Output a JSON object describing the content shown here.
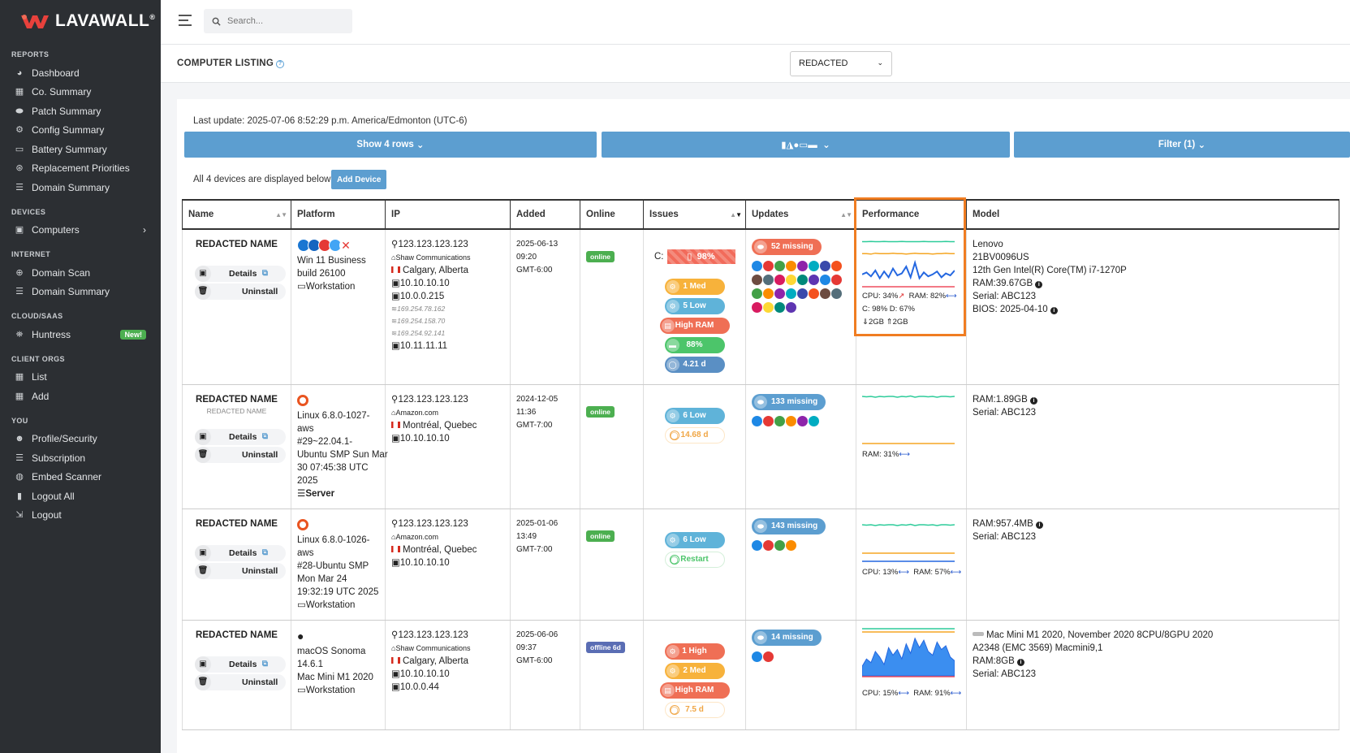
{
  "brand": {
    "name": "LAVAWALL",
    "reg": "®"
  },
  "sidebar": {
    "sections": [
      {
        "title": "REPORTS",
        "items": [
          {
            "label": "Dashboard",
            "icon": "dashboard-icon"
          },
          {
            "label": "Co. Summary",
            "icon": "building-icon"
          },
          {
            "label": "Patch Summary",
            "icon": "bandage-icon"
          },
          {
            "label": "Config Summary",
            "icon": "gear-icon"
          },
          {
            "label": "Battery Summary",
            "icon": "battery-icon"
          },
          {
            "label": "Replacement Priorities",
            "icon": "recycle-icon"
          },
          {
            "label": "Domain Summary",
            "icon": "list-icon"
          }
        ]
      },
      {
        "title": "DEVICES",
        "items": [
          {
            "label": "Computers",
            "icon": "desktop-icon",
            "chevron": "›"
          }
        ]
      },
      {
        "title": "INTERNET",
        "items": [
          {
            "label": "Domain Scan",
            "icon": "search-globe-icon"
          },
          {
            "label": "Domain Summary",
            "icon": "list-icon"
          }
        ]
      },
      {
        "title": "CLOUD/SAAS",
        "items": [
          {
            "label": "Huntress",
            "icon": "huntress-icon",
            "badge": "New!"
          }
        ]
      },
      {
        "title": "CLIENT ORGS",
        "items": [
          {
            "label": "List",
            "icon": "building-icon"
          },
          {
            "label": "Add",
            "icon": "building-add-icon"
          }
        ]
      },
      {
        "title": "YOU",
        "items": [
          {
            "label": "Profile/Security",
            "icon": "user-gear-icon"
          },
          {
            "label": "Subscription",
            "icon": "list-icon"
          },
          {
            "label": "Embed Scanner",
            "icon": "globe-icon"
          },
          {
            "label": "Logout All",
            "icon": "lock-icon"
          },
          {
            "label": "Logout",
            "icon": "logout-icon"
          }
        ]
      }
    ]
  },
  "topbar": {
    "search_placeholder": "Search..."
  },
  "page": {
    "title": "COMPUTER LISTING",
    "org_select": "REDACTED"
  },
  "content": {
    "last_update": "Last update: 2025-07-06 8:52:29 p.m. America/Edmonton (UTC-6)",
    "show_rows": "Show 4 rows",
    "platform_filter": "▮◮●▭▬",
    "filter": "Filter (1)",
    "device_count": "All 4 devices are displayed below",
    "add_device": "Add Device"
  },
  "table": {
    "headers": [
      "Name",
      "Platform",
      "IP",
      "Added",
      "Online",
      "Issues",
      "Updates",
      "Performance",
      "Model"
    ],
    "details_label": "Details",
    "uninstall_label": "Uninstall",
    "rows": [
      {
        "name": "REDACTED NAME",
        "subname": "",
        "platform_lines": [
          "Win 11 Business",
          "build 26100"
        ],
        "platform_type": "Workstation",
        "ip": {
          "public": "123.123.123.123",
          "isp": "Shaw Communications",
          "location": "Calgary, Alberta",
          "lines": [
            "10.10.10.10",
            "10.0.0.215"
          ],
          "small": [
            "169.254.78.162",
            "169.254.158.70",
            "169.254.92.141"
          ],
          "extra": "10.11.11.11"
        },
        "added": [
          "2025-06-13",
          "09:20",
          "GMT-6:00"
        ],
        "online": "online",
        "disk": {
          "label": "C:",
          "value": "98%"
        },
        "issues": [
          {
            "label": "1 Med",
            "kind": "med"
          },
          {
            "label": "5 Low",
            "kind": "low"
          },
          {
            "label": "High RAM",
            "kind": "ram"
          },
          {
            "label": "88%",
            "kind": "bat"
          },
          {
            "label": "4.21 d",
            "kind": "up"
          }
        ],
        "updates": {
          "label": "52 missing",
          "color": "red",
          "app_count": 28
        },
        "perf": {
          "text1": "CPU: 34%",
          "text1b": "RAM: 82%",
          "text2": "C: 98% D: 67%",
          "text3": "2GB",
          "text3b": "2GB",
          "cpu": [
            6,
            8,
            4,
            10,
            2,
            9,
            3,
            12,
            5,
            7,
            14,
            3,
            18,
            2,
            8,
            4,
            6,
            9,
            3,
            7,
            5,
            10
          ],
          "ram": [
            82,
            82,
            81,
            83,
            82,
            82,
            82,
            83,
            82,
            82,
            81,
            82,
            83,
            82,
            82,
            82,
            81,
            82,
            82,
            83,
            82,
            82
          ],
          "disk": [
            98,
            98,
            98,
            98,
            98,
            98,
            98,
            98,
            98,
            98,
            98,
            98,
            98,
            98,
            98,
            98,
            98,
            98,
            98,
            98,
            98,
            98
          ],
          "extra": [
            34,
            34,
            35,
            34,
            34,
            35,
            34,
            34,
            34,
            35,
            34,
            34,
            34,
            34,
            35,
            34,
            34,
            34,
            34,
            35,
            34,
            34
          ]
        },
        "model": [
          "Lenovo",
          "21BV0096US",
          "12th Gen Intel(R) Core(TM) i7-1270P",
          "RAM:39.67GB",
          "Serial: ABC123",
          "BIOS: 2025-04-10"
        ]
      },
      {
        "name": "REDACTED NAME",
        "subname": "REDACTED NAME",
        "platform_lines": [
          "Linux 6.8.0-1027-",
          "aws",
          "#29~22.04.1-",
          "Ubuntu SMP Sun Mar",
          "30 07:45:38 UTC",
          "2025"
        ],
        "platform_type": "Server",
        "ip": {
          "public": "123.123.123.123",
          "isp": "Amazon.com",
          "location": "Montréal, Quebec",
          "lines": [
            "10.10.10.10"
          ],
          "small": [],
          "extra": ""
        },
        "added": [
          "2024-12-05",
          "11:36",
          "GMT-7:00"
        ],
        "online": "online",
        "issues": [
          {
            "label": "6 Low",
            "kind": "low"
          },
          {
            "label": "14.68 d",
            "kind": "ghost"
          }
        ],
        "updates": {
          "label": "133 missing",
          "color": "blue",
          "app_count": 6
        },
        "perf": {
          "text1": "RAM: 31%",
          "ram_line": [
            64,
            64,
            63,
            64,
            64,
            64,
            64,
            64,
            64,
            64,
            64,
            64,
            64,
            64,
            64,
            64,
            64,
            64,
            64,
            64,
            64,
            64
          ],
          "top": [
            12,
            11,
            12,
            10,
            12,
            11,
            12,
            12,
            10,
            12,
            11,
            13,
            10,
            12,
            12,
            11,
            12,
            10,
            12,
            12,
            11,
            12
          ]
        },
        "model": [
          "RAM:1.89GB",
          "Serial: ABC123"
        ]
      },
      {
        "name": "REDACTED NAME",
        "subname": "",
        "platform_lines": [
          "Linux 6.8.0-1026-",
          "aws",
          "#28-Ubuntu SMP",
          "Mon Mar 24",
          "19:32:19 UTC 2025"
        ],
        "platform_type": "Workstation",
        "ip": {
          "public": "123.123.123.123",
          "isp": "Amazon.com",
          "location": "Montréal, Quebec",
          "lines": [
            "10.10.10.10"
          ],
          "small": [],
          "extra": ""
        },
        "added": [
          "2025-01-06",
          "13:49",
          "GMT-7:00"
        ],
        "online": "online",
        "issues": [
          {
            "label": "6 Low",
            "kind": "low"
          },
          {
            "label": "Restart",
            "kind": "ghost-g"
          }
        ],
        "updates": {
          "label": "143 missing",
          "color": "blue",
          "app_count": 4
        },
        "perf": {
          "text1": "CPU: 13%",
          "text1b": "RAM: 57%",
          "top": [
            14,
            13,
            14,
            12,
            14,
            13,
            14,
            14,
            12,
            14,
            13,
            15,
            12,
            14,
            14,
            13,
            14,
            12,
            14,
            14,
            13,
            14
          ]
        },
        "model": [
          "RAM:957.4MB",
          "Serial: ABC123"
        ]
      },
      {
        "name": "REDACTED NAME",
        "subname": "",
        "platform_lines": [
          "macOS Sonoma",
          "14.6.1",
          "Mac Mini M1 2020"
        ],
        "platform_type": "Workstation",
        "ip": {
          "public": "123.123.123.123",
          "isp": "Shaw Communications",
          "location": "Calgary, Alberta",
          "lines": [
            "10.10.10.10",
            "10.0.0.44"
          ],
          "small": [],
          "extra": ""
        },
        "added": [
          "2025-06-06",
          "09:37",
          "GMT-6:00"
        ],
        "online": "offline 6d",
        "issues": [
          {
            "label": "1 High",
            "kind": "high"
          },
          {
            "label": "2 Med",
            "kind": "med"
          },
          {
            "label": "High RAM",
            "kind": "ram"
          },
          {
            "label": "7.5 d",
            "kind": "ghost"
          }
        ],
        "updates": {
          "label": "14 missing",
          "color": "blue",
          "app_count": 2
        },
        "perf": {
          "text1": "CPU: 15%",
          "text1b": "RAM: 91%",
          "area": [
            10,
            18,
            14,
            26,
            20,
            12,
            30,
            22,
            28,
            18,
            34,
            24,
            40,
            30,
            38,
            26,
            22,
            36,
            28,
            32,
            20,
            16
          ]
        },
        "model": [
          "Mac Mini M1 2020, November 2020 8CPU/8GPU 2020",
          "A2348 (EMC 3569) Macmini9,1",
          "RAM:8GB",
          "Serial: ABC123"
        ]
      }
    ]
  }
}
